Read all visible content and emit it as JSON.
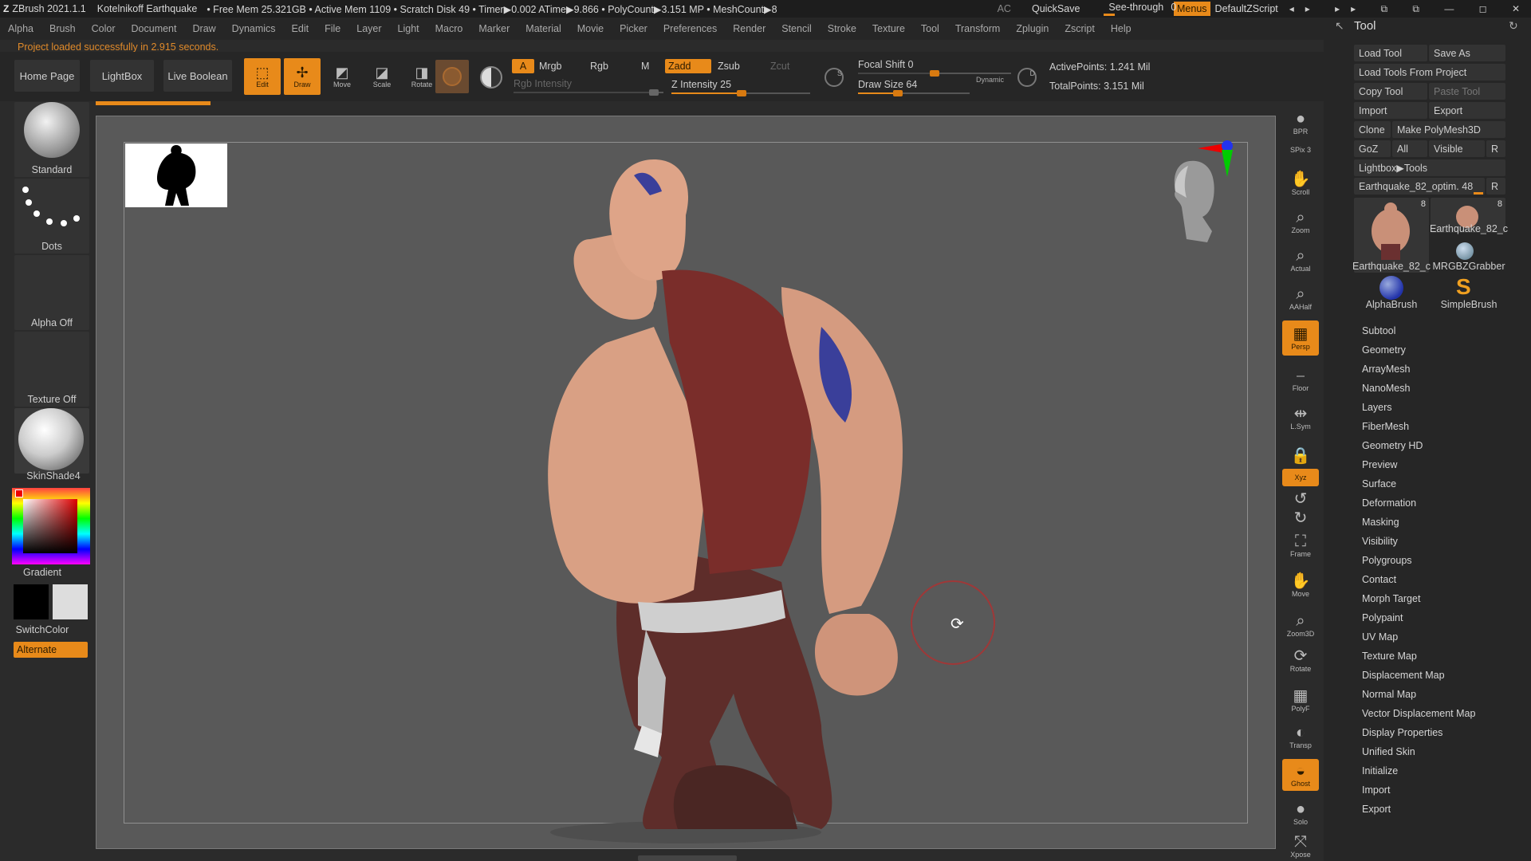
{
  "titlebar": {
    "app": "ZBrush 2021.1.1",
    "document": "Kotelnikoff Earthquake",
    "stats": "• Free Mem 25.321GB • Active Mem 1109 • Scratch Disk 49 • Timer▶0.002 ATime▶9.866 • PolyCount▶3.151 MP • MeshCount▶8",
    "ac": "AC",
    "quicksave": "QuickSave",
    "see_through": "See-through",
    "see_through_value": "0",
    "menus": "Menus",
    "script": "DefaultZScript"
  },
  "menus": [
    "Alpha",
    "Brush",
    "Color",
    "Document",
    "Draw",
    "Dynamics",
    "Edit",
    "File",
    "Layer",
    "Light",
    "Macro",
    "Marker",
    "Material",
    "Movie",
    "Picker",
    "Preferences",
    "Render",
    "Stencil",
    "Stroke",
    "Texture",
    "Tool",
    "Transform",
    "Zplugin",
    "Zscript",
    "Help"
  ],
  "status": "Project loaded successfully in 2.915 seconds.",
  "toolbar": {
    "home": "Home Page",
    "lightbox": "LightBox",
    "live_boolean": "Live Boolean",
    "edit": "Edit",
    "draw": "Draw",
    "move": "Move",
    "scale": "Scale",
    "rotate": "Rotate",
    "a": "A",
    "mrgb": "Mrgb",
    "rgb": "Rgb",
    "m": "M",
    "zadd": "Zadd",
    "zsub": "Zsub",
    "zcut": "Zcut",
    "rgb_intensity": "Rgb Intensity",
    "z_intensity": "Z Intensity 25",
    "focal_shift": "Focal Shift 0",
    "draw_size": "Draw Size 64",
    "dynamic": "Dynamic",
    "active_points": "ActivePoints: 1.241 Mil",
    "total_points": "TotalPoints: 3.151 Mil"
  },
  "leftshelf": {
    "brush": "Standard",
    "stroke": "Dots",
    "alpha": "Alpha Off",
    "texture": "Texture Off",
    "material": "SkinShade4",
    "gradient": "Gradient",
    "switch": "SwitchColor",
    "alternate": "Alternate"
  },
  "rightshelf": [
    "BPR",
    "SPix 3",
    "Scroll",
    "Zoom",
    "Actual",
    "AAHalf",
    "Persp",
    "Floor",
    "L.Sym",
    "",
    "Xyz",
    "",
    "",
    "Frame",
    "Move",
    "Zoom3D",
    "Rotate",
    "PolyF",
    "Transp",
    "Ghost",
    "Solo",
    "Xpose"
  ],
  "tool": {
    "title": "Tool",
    "load": "Load Tool",
    "save_as": "Save As",
    "load_from_project": "Load Tools From Project",
    "copy": "Copy Tool",
    "paste": "Paste Tool",
    "import": "Import",
    "export": "Export",
    "clone": "Clone",
    "make_polymesh": "Make PolyMesh3D",
    "goz": "GoZ",
    "all": "All",
    "visible": "Visible",
    "r": "R",
    "lightbox_tools": "Lightbox▶Tools",
    "current": "Earthquake_82_optim. 48",
    "thumbs": [
      {
        "label": "Earthquake_82_c",
        "count": "8"
      },
      {
        "label": "Earthquake_82_c",
        "count": "8"
      },
      {
        "label": "MRGBZGrabber",
        "count": ""
      },
      {
        "label": "AlphaBrush",
        "count": ""
      },
      {
        "label": "SimpleBrush",
        "count": ""
      }
    ],
    "sections": [
      "Subtool",
      "Geometry",
      "ArrayMesh",
      "NanoMesh",
      "Layers",
      "FiberMesh",
      "Geometry HD",
      "Preview",
      "Surface",
      "Deformation",
      "Masking",
      "Visibility",
      "Polygroups",
      "Contact",
      "Morph Target",
      "Polypaint",
      "UV Map",
      "Texture Map",
      "Displacement Map",
      "Normal Map",
      "Vector Displacement Map",
      "Display Properties",
      "Unified Skin",
      "Initialize",
      "Import",
      "Export"
    ]
  },
  "colors": {
    "accent": "#e88a1a",
    "skin": "#d9a084",
    "vest": "#7a2d2a",
    "pants": "#5e2d2a",
    "tattoo": "#3a3f9a"
  }
}
